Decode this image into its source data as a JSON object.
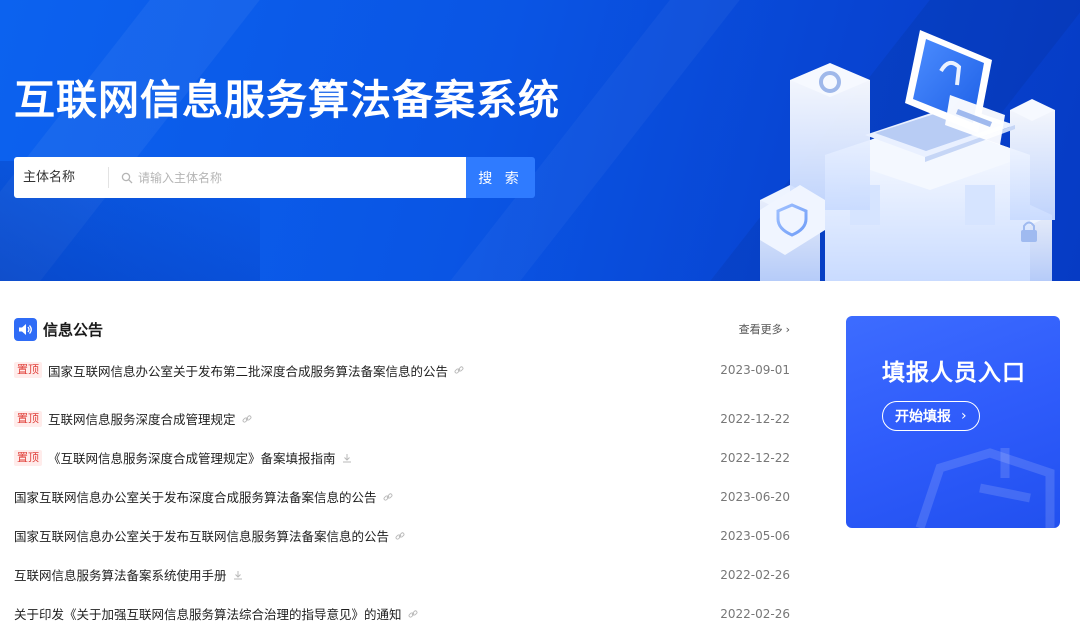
{
  "hero": {
    "title": "互联网信息服务算法备案系统",
    "search": {
      "type_label": "主体名称",
      "placeholder": "请输入主体名称",
      "button_label": "搜 索"
    }
  },
  "notice": {
    "title": "信息公告",
    "more_label": "查看更多",
    "items": [
      {
        "pinned": true,
        "pin_label": "置顶",
        "text": "国家互联网信息办公室关于发布第二批深度合成服务算法备案信息的公告",
        "icon": "link-icon",
        "date": "2023-09-01"
      },
      {
        "pinned": true,
        "pin_label": "置顶",
        "text": "互联网信息服务深度合成管理规定",
        "icon": "link-icon",
        "date": "2022-12-22"
      },
      {
        "pinned": true,
        "pin_label": "置顶",
        "text": "《互联网信息服务深度合成管理规定》备案填报指南",
        "icon": "download-icon",
        "date": "2022-12-22"
      },
      {
        "pinned": false,
        "pin_label": "",
        "text": "国家互联网信息办公室关于发布深度合成服务算法备案信息的公告",
        "icon": "link-icon",
        "date": "2023-06-20"
      },
      {
        "pinned": false,
        "pin_label": "",
        "text": "国家互联网信息办公室关于发布互联网信息服务算法备案信息的公告",
        "icon": "link-icon",
        "date": "2023-05-06"
      },
      {
        "pinned": false,
        "pin_label": "",
        "text": "互联网信息服务算法备案系统使用手册",
        "icon": "download-icon",
        "date": "2022-02-26"
      },
      {
        "pinned": false,
        "pin_label": "",
        "text": "关于印发《关于加强互联网信息服务算法综合治理的指导意见》的通知",
        "icon": "link-icon",
        "date": "2022-02-26"
      }
    ]
  },
  "entry": {
    "title": "填报人员入口",
    "button_label": "开始填报"
  },
  "colors": {
    "brand_blue": "#2f7bff",
    "hero_blue": "#0a55e4",
    "pin_red": "#e0403a",
    "card_blue": "#2f5cfb"
  }
}
